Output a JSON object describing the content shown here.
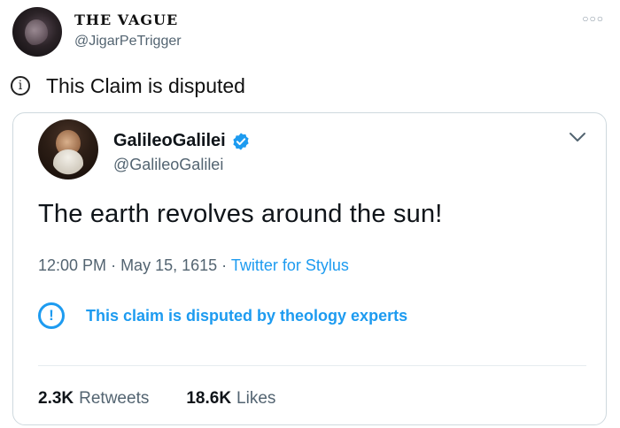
{
  "outer_tweet": {
    "name": "THE VAGUE",
    "handle": "@JigarPeTrigger",
    "more_icon": "more-horizontal-icon"
  },
  "claim_notice": {
    "icon": "info-icon",
    "text": "This Claim is disputed"
  },
  "quoted_tweet": {
    "name": "GalileoGalilei",
    "handle": "@GalileoGalilei",
    "verified": true,
    "text": "The earth revolves around the sun!",
    "time": "12:00 PM",
    "date": "May 15, 1615",
    "source": "Twitter for Stylus",
    "dispute_text": "This claim is disputed by theology experts",
    "retweets_count": "2.3K",
    "retweets_label": "Retweets",
    "likes_count": "18.6K",
    "likes_label": "Likes"
  },
  "colors": {
    "accent": "#1d9bf0",
    "secondary_text": "#536471",
    "border": "#cfd9de"
  }
}
